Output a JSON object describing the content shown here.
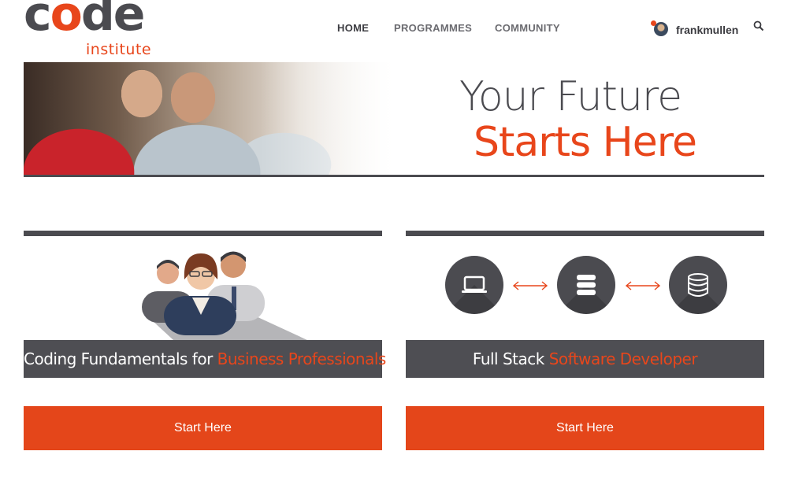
{
  "logo": {
    "word": "code",
    "sub": "institute"
  },
  "nav": {
    "items": [
      "HOME",
      "PROGRAMMES",
      "COMMUNITY"
    ],
    "active": "HOME"
  },
  "user": {
    "name": "frankmullen"
  },
  "hero": {
    "line1": "Your Future",
    "line2": "Starts Here"
  },
  "cards": [
    {
      "title_plain": "Coding Fundamentals for ",
      "title_accent": "Business Professionals",
      "button": "Start Here"
    },
    {
      "title_plain": "Full Stack ",
      "title_accent": "Software Developer",
      "button": "Start Here"
    }
  ],
  "colors": {
    "accent": "#e8461b",
    "dark": "#4b4b50",
    "button": "#e4461a"
  },
  "icons": [
    "search-icon",
    "laptop-icon",
    "server-icon",
    "database-icon",
    "double-arrow-icon"
  ]
}
